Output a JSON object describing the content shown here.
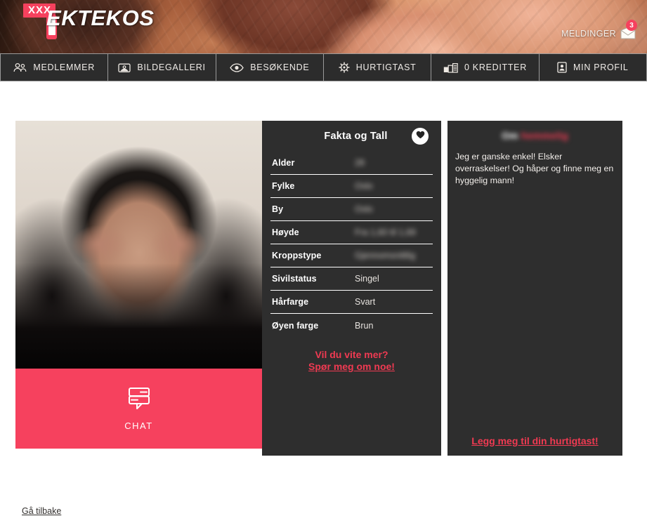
{
  "brand": {
    "badge": "XXX",
    "name": "EKTEKOS"
  },
  "header": {
    "messages_label": "MELDINGER",
    "messages_count": "3",
    "messages_icon": "envelope-icon"
  },
  "nav": {
    "items": [
      {
        "label": "MEDLEMMER",
        "icon": "members-icon"
      },
      {
        "label": "BILDEGALLERI",
        "icon": "gallery-icon"
      },
      {
        "label": "BESØKENDE",
        "icon": "eye-icon"
      },
      {
        "label": "HURTIGTAST",
        "icon": "star-gear-icon"
      },
      {
        "label": "0 KREDITTER",
        "icon": "credits-icon"
      },
      {
        "label": "MIN PROFIL",
        "icon": "profile-card-icon"
      }
    ]
  },
  "profile": {
    "photo_alt": "profile-photo",
    "carousel_dots": 3,
    "chat_button": {
      "label": "CHAT",
      "icon": "chat-bubbles-icon"
    }
  },
  "facts": {
    "title": "Fakta og Tall",
    "favorite_icon": "heart-icon",
    "rows": [
      {
        "key": "Alder",
        "value": "28",
        "hidden": true
      },
      {
        "key": "Fylke",
        "value": "Oslo",
        "hidden": true
      },
      {
        "key": "By",
        "value": "Oslo",
        "hidden": true
      },
      {
        "key": "Høyde",
        "value": "Fra 1,60 til 1,69",
        "hidden": true
      },
      {
        "key": "Kroppstype",
        "value": "Gjennomsnittlig",
        "hidden": true
      },
      {
        "key": "Sivilstatus",
        "value": "Singel",
        "hidden": false
      },
      {
        "key": "Hårfarge",
        "value": "Svart",
        "hidden": false
      },
      {
        "key": "Øyen farge",
        "value": "Brun",
        "hidden": false
      }
    ],
    "cta_line1": "Vil du vite mer?",
    "cta_line2": "Spør meg om noe!"
  },
  "about": {
    "title_prefix": "Om",
    "title_name": "hemmelig",
    "text": "Jeg er ganske enkel! Elsker overraskelser! Og håper og finne meg en hyggelig mann!",
    "cta": "Legg meg til din hurtigtast!"
  },
  "footer": {
    "back_link": "Gå tilbake"
  },
  "colors": {
    "accent": "#f6415e",
    "link_red": "#f03a52",
    "panel": "#2e2e2e",
    "nav_bg": "#2c2c2c"
  }
}
